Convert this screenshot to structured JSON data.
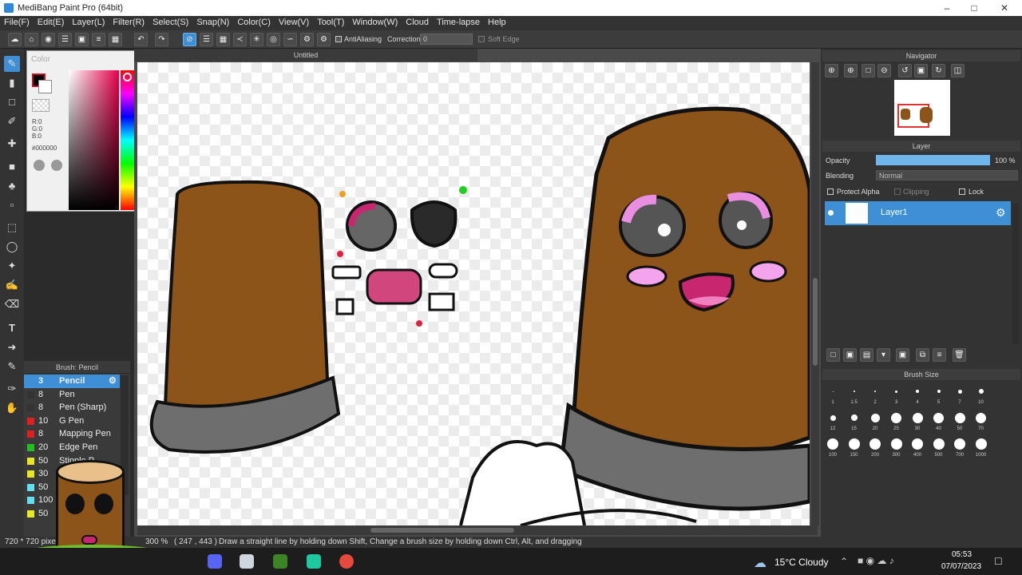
{
  "window": {
    "title": "MediBang Paint Pro (64bit)"
  },
  "menu": [
    "File(F)",
    "Edit(E)",
    "Layer(L)",
    "Filter(R)",
    "Select(S)",
    "Snap(N)",
    "Color(C)",
    "View(V)",
    "Tool(T)",
    "Window(W)",
    "Cloud",
    "Time-lapse",
    "Help"
  ],
  "toolbar": {
    "antialiasing_label": "AntiAliasing",
    "correction_label": "Correction",
    "correction_value": "0",
    "soft_edge_label": "Soft Edge"
  },
  "canvas": {
    "tab_title": "Untitled"
  },
  "color_panel": {
    "title": "Color",
    "r": "R:0",
    "g": "G:0",
    "b": "B:0",
    "hex": "#000000"
  },
  "brush_panel": {
    "title": "Brush: Pencil",
    "items": [
      {
        "size": "3",
        "name": "Pencil",
        "color": "#3f8fd6",
        "selected": true
      },
      {
        "size": "8",
        "name": "Pen",
        "color": "#333333"
      },
      {
        "size": "8",
        "name": "Pen (Sharp)",
        "color": "#333333"
      },
      {
        "size": "10",
        "name": "G Pen",
        "color": "#e02020"
      },
      {
        "size": "8",
        "name": "Mapping Pen",
        "color": "#e02020"
      },
      {
        "size": "20",
        "name": "Edge Pen",
        "color": "#20c020"
      },
      {
        "size": "50",
        "name": "Stipple P...",
        "color": "#e8e820"
      },
      {
        "size": "30",
        "name": "",
        "color": "#e8e820"
      },
      {
        "size": "50",
        "name": "",
        "color": "#60e0f0"
      },
      {
        "size": "100",
        "name": "",
        "color": "#60e0f0"
      },
      {
        "size": "50",
        "name": "",
        "color": "#e8e820"
      }
    ]
  },
  "navigator": {
    "title": "Navigator"
  },
  "layer_panel": {
    "title": "Layer",
    "opacity_label": "Opacity",
    "opacity_value": "100 %",
    "opacity_fraction": 1.0,
    "blending_label": "Blending",
    "blending_value": "Normal",
    "protect_alpha": "Protect Alpha",
    "clipping": "Clipping",
    "lock": "Lock",
    "layer_name": "Layer1"
  },
  "brush_size_panel": {
    "title": "Brush Size",
    "row1": [
      "1",
      "1.5",
      "2",
      "3",
      "4",
      "5",
      "7",
      "10"
    ],
    "row2": [
      "12",
      "15",
      "20",
      "25",
      "30",
      "40",
      "50",
      "70"
    ],
    "row3": [
      "100",
      "150",
      "200",
      "300",
      "400",
      "500",
      "700",
      "1000"
    ]
  },
  "status": {
    "size": "720 * 720 pixel",
    "zoom": "300 %",
    "coords": "( 247 , 443 )",
    "hint": "Draw a straight line by holding down Shift, Change a brush size by holding down Ctrl, Alt, and dragging"
  },
  "taskbar": {
    "weather": "15°C  Cloudy",
    "time": "05:53",
    "date": "07/07/2023"
  }
}
